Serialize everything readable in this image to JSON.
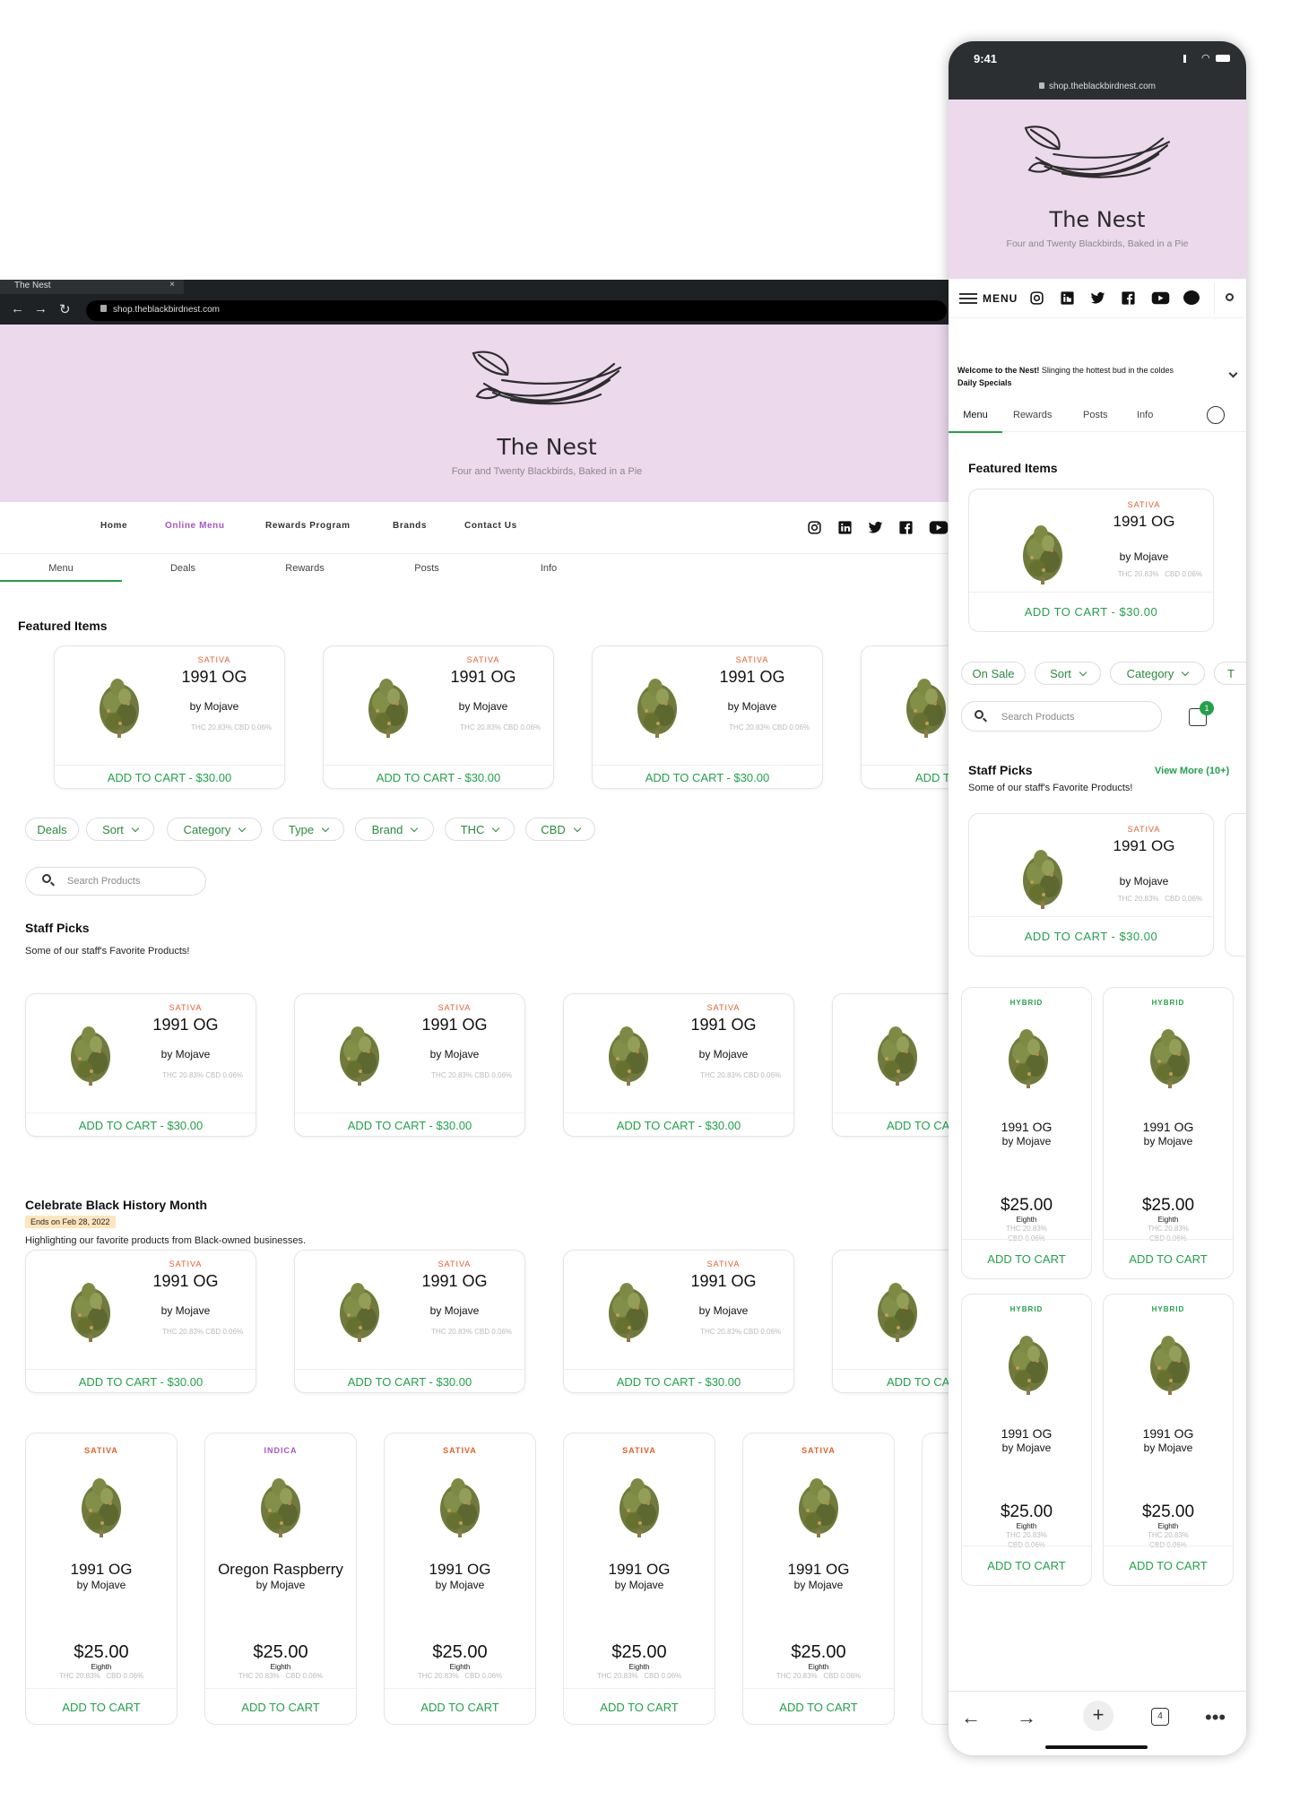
{
  "desktop": {
    "browser": {
      "tab_title": "The Nest",
      "tab_close": "×",
      "url": "shop.theblackbirdnest.com"
    },
    "brand": {
      "name": "The Nest",
      "tagline": "Four and Twenty Blackbirds, Baked in a Pie"
    },
    "topnav": [
      "Home",
      "Online Menu",
      "Rewards Program",
      "Brands",
      "Contact Us"
    ],
    "active_topnav": "Online Menu",
    "subtabs": [
      "Menu",
      "Deals",
      "Rewards",
      "Posts",
      "Info"
    ],
    "featured_title": "Featured Items",
    "filters": [
      "Deals",
      "Sort",
      "Category",
      "Type",
      "Brand",
      "THC",
      "CBD"
    ],
    "search_placeholder": "Search Products",
    "staff": {
      "title": "Staff Picks",
      "desc": "Some of our staff's Favorite Products!"
    },
    "bhm": {
      "title": "Celebrate Black History Month",
      "ends": "Ends on Feb 28, 2022",
      "desc": "Highlighting our favorite products from Black-owned businesses."
    },
    "product_card": {
      "strain": "SATIVA",
      "name": "1991 OG",
      "brand": "by Mojave",
      "thc": "THC 20.83%",
      "cbd": "CBD 0.06%",
      "cta": "ADD TO CART - $30.00",
      "cta_partial": "ADD T",
      "cta_partial2": "ADD TO CA"
    },
    "grid_cards": [
      {
        "strain": "SATIVA",
        "name": "1991 OG",
        "brand": "by Mojave",
        "price": "$25.00",
        "weight": "Eighth",
        "thc": "THC 20.83%",
        "cbd": "CBD 0.06%",
        "cta": "ADD TO CART"
      },
      {
        "strain": "INDICA",
        "name": "Oregon Raspberry",
        "brand": "by Mojave",
        "price": "$25.00",
        "weight": "Eighth",
        "thc": "THC 20.83%",
        "cbd": "CBD 0.06%",
        "cta": "ADD TO CART"
      },
      {
        "strain": "SATIVA",
        "name": "1991 OG",
        "brand": "by Mojave",
        "price": "$25.00",
        "weight": "Eighth",
        "thc": "THC 20.83%",
        "cbd": "CBD 0.06%",
        "cta": "ADD TO CART"
      },
      {
        "strain": "SATIVA",
        "name": "1991 OG",
        "brand": "by Mojave",
        "price": "$25.00",
        "weight": "Eighth",
        "thc": "THC 20.83%",
        "cbd": "CBD 0.06%",
        "cta": "ADD TO CART"
      },
      {
        "strain": "SATIVA",
        "name": "1991 OG",
        "brand": "by Mojave",
        "price": "$25.00",
        "weight": "Eighth",
        "thc": "THC 20.83%",
        "cbd": "CBD 0.06%",
        "cta": "ADD TO CART"
      }
    ],
    "colors": {
      "sativa": "#e1602b",
      "indica": "#a855c7",
      "hybrid": "#22a14a",
      "accent": "#22a14a",
      "hero": "#ecd9ec"
    }
  },
  "phone": {
    "time": "9:41",
    "url": "shop.theblackbirdnest.com",
    "menu_label": "MENU",
    "welcome_bold": "Welcome to the Nest!",
    "welcome_rest": " Slinging the hottest bud in the coldes",
    "daily_specials": "Daily Specials",
    "tabs": [
      "Menu",
      "Rewards",
      "Posts",
      "Info"
    ],
    "featured_title": "Featured Items",
    "filters": [
      "On Sale",
      "Sort",
      "Category",
      "T"
    ],
    "search_placeholder": "Search Products",
    "cart_count": "1",
    "staff": {
      "title": "Staff Picks",
      "view_more": "View More (10+)",
      "desc": "Some of our staff's Favorite Products!"
    },
    "grid_card": {
      "strain": "HYBRID",
      "name": "1991 OG",
      "brand": "by Mojave",
      "price": "$25.00",
      "weight": "Eighth",
      "thc": "THC 20.83%",
      "cbd": "CBD 0.06%",
      "cta": "ADD TO CART"
    },
    "tab_count": "4"
  }
}
